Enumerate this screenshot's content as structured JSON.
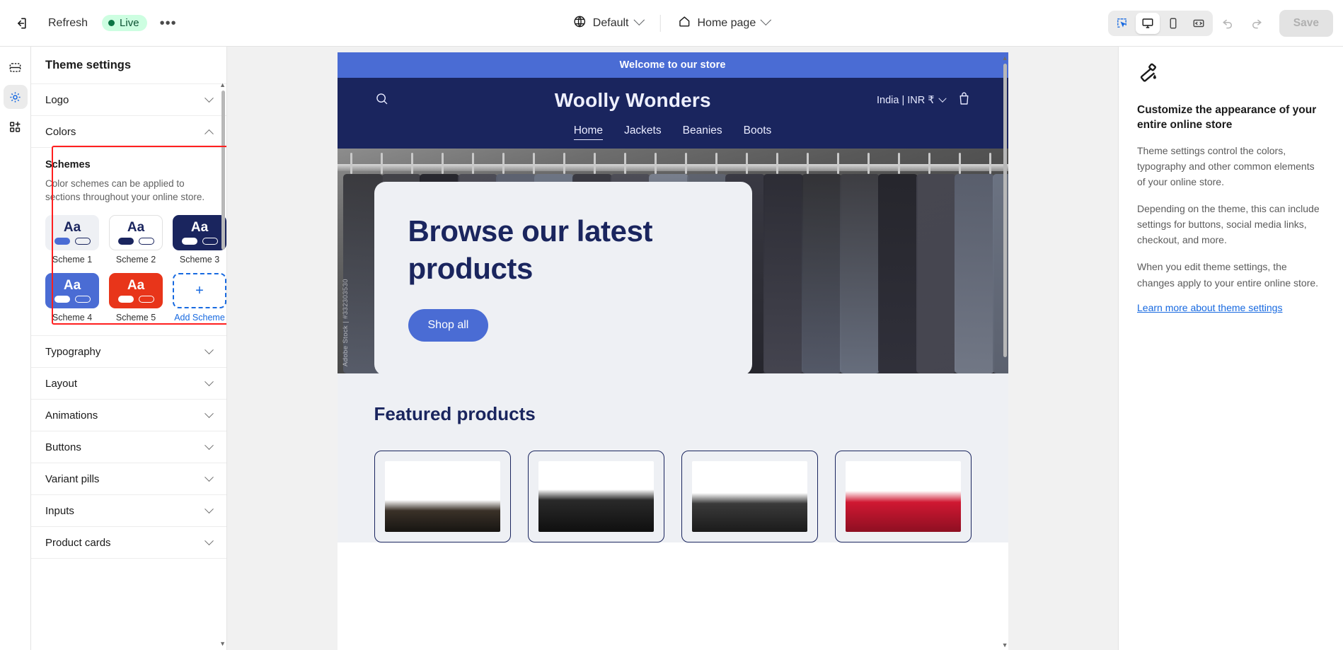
{
  "topbar": {
    "exit_icon": "exit-icon",
    "refresh_label": "Refresh",
    "live_label": "Live",
    "more_label": "•••",
    "theme_selector": "Default",
    "page_selector": "Home page",
    "globe_icon": "globe-icon",
    "home_icon": "home-icon",
    "select_tool_icon": "select-tool-icon",
    "desktop_icon": "desktop-icon",
    "mobile_icon": "mobile-icon",
    "fullwidth_icon": "fullwidth-icon",
    "undo_icon": "undo-icon",
    "redo_icon": "redo-icon",
    "save_label": "Save"
  },
  "rail": {
    "sections_icon": "sections-icon",
    "theme_settings_icon": "gear-icon",
    "apps_icon": "apps-add-icon"
  },
  "left_panel": {
    "title": "Theme settings",
    "groups": [
      {
        "label": "Logo",
        "expanded": false
      },
      {
        "label": "Colors",
        "expanded": true
      }
    ],
    "schemes": {
      "title": "Schemes",
      "description": "Color schemes can be applied to sections throughout your online store.",
      "items": [
        {
          "label": "Scheme 1",
          "bg": "#eef0f4",
          "text": "#1a255e",
          "solid_pill": "#4a6cd4",
          "outline_pill": "#1a255e",
          "border": "#eef0f4"
        },
        {
          "label": "Scheme 2",
          "bg": "#ffffff",
          "text": "#1a255e",
          "solid_pill": "#1a255e",
          "outline_pill": "#1a255e",
          "border": "#e1e1e1"
        },
        {
          "label": "Scheme 3",
          "bg": "#1a255e",
          "text": "#ffffff",
          "solid_pill": "#ffffff",
          "outline_pill": "#ffffff",
          "border": "#1a255e"
        },
        {
          "label": "Scheme 4",
          "bg": "#4a6cd4",
          "text": "#ffffff",
          "solid_pill": "#ffffff",
          "outline_pill": "#ffffff",
          "border": "#4a6cd4"
        },
        {
          "label": "Scheme 5",
          "bg": "#e8351a",
          "text": "#ffffff",
          "solid_pill": "#ffffff",
          "outline_pill": "#ffffff",
          "border": "#e8351a"
        }
      ],
      "add_label": "Add Scheme",
      "add_icon": "plus-icon"
    },
    "rest_groups": [
      {
        "label": "Typography"
      },
      {
        "label": "Layout"
      },
      {
        "label": "Animations"
      },
      {
        "label": "Buttons"
      },
      {
        "label": "Variant pills"
      },
      {
        "label": "Inputs"
      },
      {
        "label": "Product cards"
      }
    ],
    "highlight_color": "#ff1f1f"
  },
  "preview": {
    "announcement": "Welcome to our store",
    "store_name": "Woolly Wonders",
    "search_icon": "search-icon",
    "cart_icon": "cart-icon",
    "currency": "India | INR ₹",
    "nav": [
      {
        "label": "Home",
        "current": true
      },
      {
        "label": "Jackets",
        "current": false
      },
      {
        "label": "Beanies",
        "current": false
      },
      {
        "label": "Boots",
        "current": false
      }
    ],
    "hero": {
      "heading": "Browse our latest products",
      "button": "Shop all",
      "watermark": "Adobe Stock | #332303530"
    },
    "featured": {
      "heading": "Featured products",
      "cards": [
        "product-boots",
        "product-puffer-jacket",
        "product-leather-jacket",
        "product-pompom-beanie"
      ]
    },
    "colors": {
      "announcement_bg": "#4a6cd4",
      "header_bg": "#1a255e",
      "section_bg": "#eef0f4",
      "brand_navy": "#1a255e",
      "brand_blue": "#4a6cd4"
    }
  },
  "right_panel": {
    "icon": "paint-roller-icon",
    "title": "Customize the appearance of your entire online store",
    "paragraphs": [
      "Theme settings control the colors, typography and other common elements of your online store.",
      "Depending on the theme, this can include settings for buttons, social media links, checkout, and more.",
      "When you edit theme settings, the changes apply to your entire online store."
    ],
    "link": "Learn more about theme settings"
  }
}
